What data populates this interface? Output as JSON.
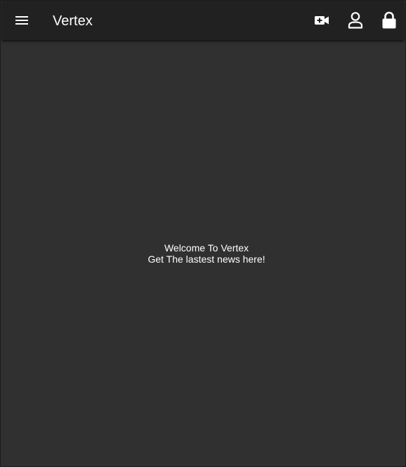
{
  "app_bar": {
    "title": "Vertex",
    "menu_icon": "menu-icon",
    "actions": [
      {
        "name": "add-video-button",
        "icon": "video-plus-icon"
      },
      {
        "name": "account-button",
        "icon": "person-icon"
      },
      {
        "name": "lock-button",
        "icon": "lock-icon"
      }
    ]
  },
  "main": {
    "welcome_line1": "Welcome To Vertex",
    "welcome_line2": "Get The lastest news here!"
  },
  "colors": {
    "background": "#303030",
    "app_bar": "#212121",
    "text": "#ffffff"
  }
}
